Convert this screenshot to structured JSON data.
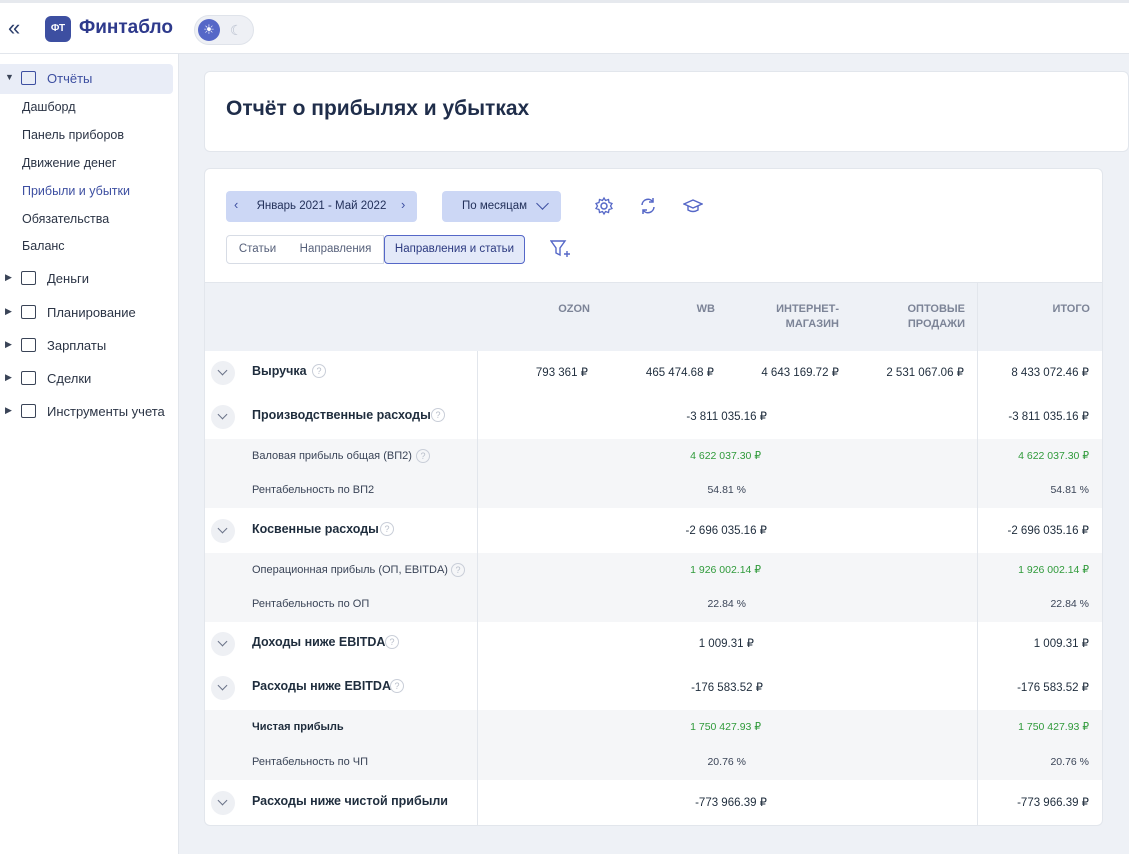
{
  "app": {
    "logo_badge": "ФТ",
    "logo_text": "Финтабло",
    "collapse_glyph": "«"
  },
  "sidebar": {
    "reports_label": "Отчёты",
    "report_items": [
      "Дашборд",
      "Панель приборов",
      "Движение денег",
      "Прибыли и убытки",
      "Обязательства",
      "Баланс"
    ],
    "active_item": "Прибыли и убытки",
    "groups": [
      "Деньги",
      "Планирование",
      "Зарплаты",
      "Сделки",
      "Инструменты учета"
    ]
  },
  "page": {
    "title": "Отчёт о прибылях и убытках"
  },
  "toolbar": {
    "period": "Январь 2021 - Май 2022",
    "grouping": "По месяцам",
    "icons": [
      "gear-icon",
      "refresh-icon",
      "graduation-cap-icon",
      "filter-add-icon"
    ]
  },
  "view_tabs": [
    "Статьи",
    "Направления",
    "Направления и статьи"
  ],
  "active_tab": "Направления и статьи",
  "columns": {
    "ozon": "OZON",
    "wb": "WB",
    "internet": [
      "ИНТЕРНЕТ-",
      "МАГАЗИН"
    ],
    "wholesale": [
      "ОПТОВЫЕ",
      "ПРОДАЖИ"
    ],
    "total": "ИТОГО"
  },
  "rows": {
    "revenue": {
      "label": "Выручка",
      "ozon": "793 361 ₽",
      "wb": "465 474.68 ₽",
      "internet": "4 643 169.72 ₽",
      "wholesale": "2 531 067.06 ₽",
      "total": "8 433 072.46 ₽"
    },
    "production": {
      "label": "Производственные расходы",
      "value": "-3 811 035.16 ₽",
      "total": "-3 811 035.16 ₽"
    },
    "gross_profit": {
      "label": "Валовая прибыль общая (ВП2)",
      "value": "4 622 037.30 ₽",
      "total": "4 622 037.30 ₽"
    },
    "gross_margin": {
      "label": "Рентабельность по ВП2",
      "value": "54.81 %",
      "total": "54.81 %"
    },
    "indirect": {
      "label": "Косвенные расходы",
      "value": "-2 696 035.16 ₽",
      "total": "-2 696 035.16 ₽"
    },
    "ebitda": {
      "label": "Операционная прибыль (ОП, EBITDA)",
      "value": "1 926 002.14 ₽",
      "total": "1 926 002.14 ₽"
    },
    "op_margin": {
      "label": "Рентабельность по ОП",
      "value": "22.84 %",
      "total": "22.84 %"
    },
    "income_below": {
      "label": "Доходы ниже EBITDA",
      "value": "1 009.31 ₽",
      "total": "1 009.31 ₽"
    },
    "expenses_below": {
      "label": "Расходы ниже EBITDA",
      "value": "-176 583.52 ₽",
      "total": "-176 583.52 ₽"
    },
    "net_profit": {
      "label": "Чистая прибыль",
      "value": "1 750 427.93 ₽",
      "total": "1 750 427.93 ₽"
    },
    "net_margin": {
      "label": "Рентабельность по ЧП",
      "value": "20.76 %",
      "total": "20.76 %"
    },
    "below_net": {
      "label": "Расходы ниже чистой прибыли",
      "value": "-773 966.39 ₽",
      "total": "-773 966.39 ₽"
    }
  }
}
